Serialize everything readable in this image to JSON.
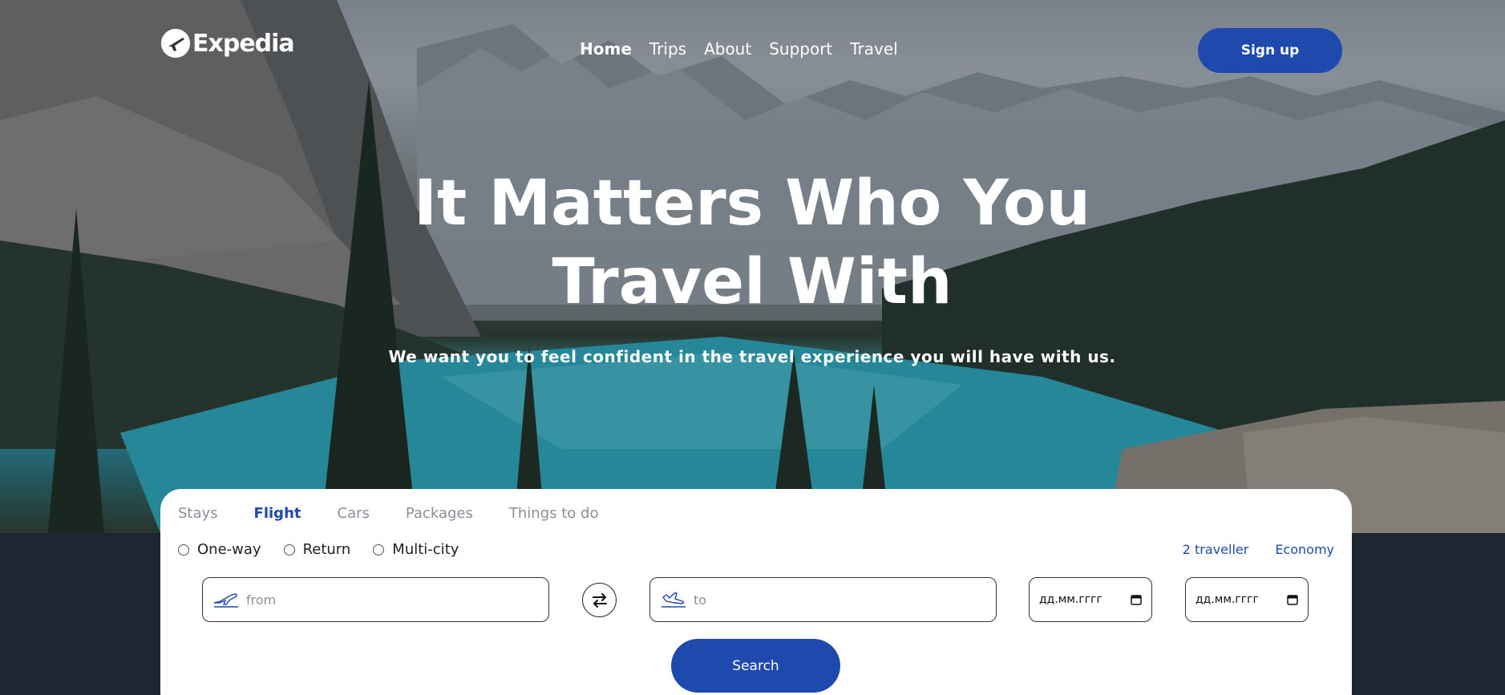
{
  "brand": {
    "name": "Expedia"
  },
  "nav": {
    "items": [
      {
        "label": "Home",
        "active": true
      },
      {
        "label": "Trips",
        "active": false
      },
      {
        "label": "About",
        "active": false
      },
      {
        "label": "Support",
        "active": false
      },
      {
        "label": "Travel",
        "active": false
      }
    ]
  },
  "header": {
    "signup_label": "Sign up"
  },
  "hero": {
    "title_line1": "It Matters Who You",
    "title_line2": "Travel With",
    "subtitle": "We want you to feel confident in the travel experience you will have with us."
  },
  "search": {
    "tabs": [
      {
        "label": "Stays",
        "active": false
      },
      {
        "label": "Flight",
        "active": true
      },
      {
        "label": "Cars",
        "active": false
      },
      {
        "label": "Packages",
        "active": false
      },
      {
        "label": "Things to do",
        "active": false
      }
    ],
    "trip_types": [
      "One-way",
      "Return",
      "Multi-city"
    ],
    "travellers": "2 traveller",
    "cabin_class": "Economy",
    "from_placeholder": "from",
    "to_placeholder": "to",
    "date1_placeholder": "дд.мм.гггг",
    "date2_placeholder": "дд.мм.гггг",
    "search_label": "Search"
  },
  "colors": {
    "accent": "#1f4aad",
    "dark_band": "#1f2633"
  },
  "icons": [
    "expedia-logo-icon",
    "plane-takeoff-icon",
    "swap-icon",
    "plane-landing-icon",
    "calendar-icon"
  ]
}
